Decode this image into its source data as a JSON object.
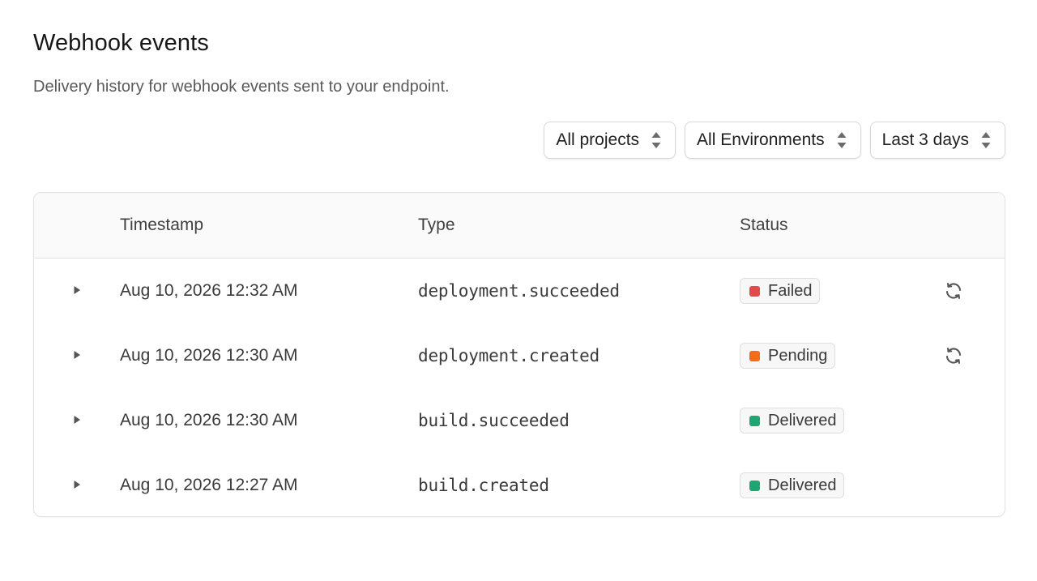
{
  "header": {
    "title": "Webhook events",
    "subtitle": "Delivery history for webhook events sent to your endpoint."
  },
  "filters": {
    "project": "All projects",
    "environment": "All Environments",
    "range": "Last 3 days"
  },
  "table": {
    "columns": [
      "Timestamp",
      "Type",
      "Status"
    ],
    "rows": [
      {
        "timestamp": "Aug 10, 2026 12:32 AM",
        "type": "deployment.succeeded",
        "status": "Failed",
        "status_color": "#e5484d",
        "retry": true
      },
      {
        "timestamp": "Aug 10, 2026 12:30 AM",
        "type": "deployment.created",
        "status": "Pending",
        "status_color": "#f76b15",
        "retry": true
      },
      {
        "timestamp": "Aug 10, 2026 12:30 AM",
        "type": "build.succeeded",
        "status": "Delivered",
        "status_color": "#1ba672",
        "retry": false
      },
      {
        "timestamp": "Aug 10, 2026 12:27 AM",
        "type": "build.created",
        "status": "Delivered",
        "status_color": "#1ba672",
        "retry": false
      }
    ]
  },
  "icons": {
    "expand": "caret-right-icon",
    "retry": "refresh-icon",
    "select": "sort-arrows-icon"
  }
}
